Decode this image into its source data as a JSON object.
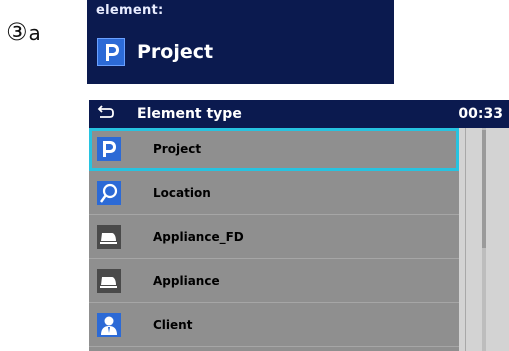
{
  "step": {
    "number": "③",
    "letter": "a"
  },
  "element_card": {
    "caption": "element:",
    "name": "Project",
    "icon": "project-p-icon"
  },
  "screen": {
    "header": {
      "back_icon": "back-arrow-icon",
      "title": "Element type",
      "time": "00:33"
    },
    "list": {
      "selected_index": 0,
      "items": [
        {
          "label": "Project",
          "icon": "project-p-icon"
        },
        {
          "label": "Location",
          "icon": "location-pin-icon"
        },
        {
          "label": "Appliance_FD",
          "icon": "iron-appliance-icon"
        },
        {
          "label": "Appliance",
          "icon": "iron-appliance-icon"
        },
        {
          "label": "Client",
          "icon": "client-person-icon"
        }
      ]
    }
  },
  "colors": {
    "header_bg": "#0b1a4f",
    "list_bg": "#8f8f8f",
    "selection_outline": "#27c3e0",
    "icon_blue": "#2c6ad6"
  }
}
